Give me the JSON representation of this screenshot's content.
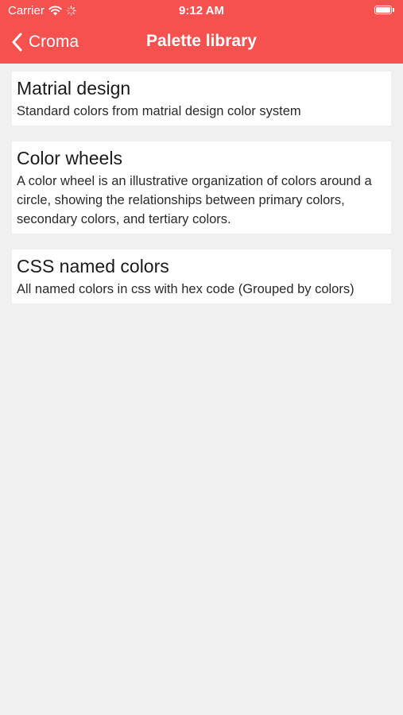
{
  "status_bar": {
    "carrier": "Carrier",
    "time": "9:12 AM",
    "icons": [
      "wifi-icon",
      "activity-spinner-icon",
      "battery-icon"
    ]
  },
  "nav": {
    "back_label": "Croma",
    "back_icon": "chevron-left-icon",
    "title": "Palette library"
  },
  "colors": {
    "header_bg": "#f4514f",
    "page_bg": "#f0f0f0",
    "card_bg": "#ffffff"
  },
  "palettes": [
    {
      "title": "Matrial design",
      "description": "Standard colors from matrial design color system"
    },
    {
      "title": "Color wheels",
      "description": "A color wheel is an illustrative organization of colors around a circle, showing the relationships between primary colors, secondary colors, and tertiary colors."
    },
    {
      "title": "CSS named colors",
      "description": "All named colors in css with hex code (Grouped by colors)"
    }
  ]
}
